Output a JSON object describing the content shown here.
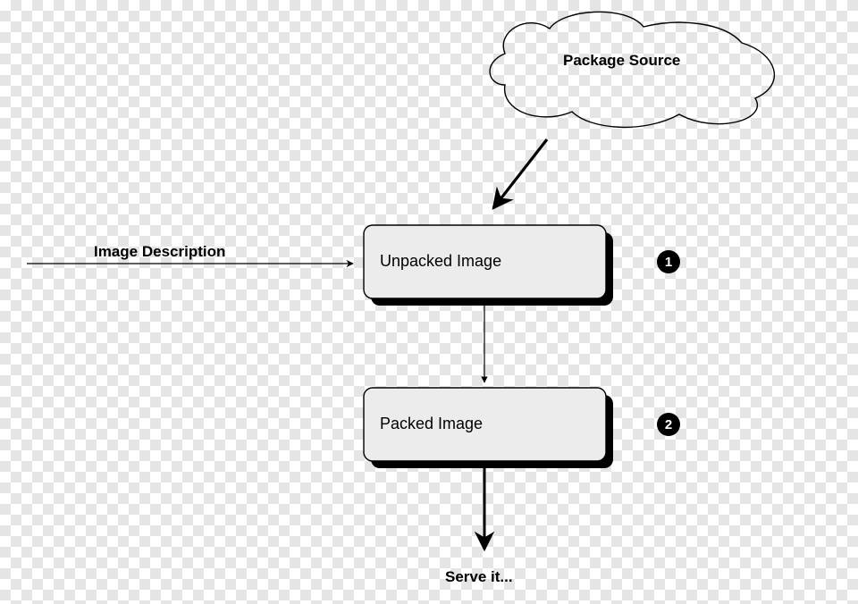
{
  "nodes": {
    "package_source": "Package Source",
    "image_description": "Image Description",
    "unpacked_image": "Unpacked Image",
    "packed_image": "Packed Image",
    "serve_it": "Serve it..."
  },
  "steps": {
    "one": "1",
    "two": "2"
  },
  "colors": {
    "box_fill": "#ececec",
    "stroke": "#000000"
  }
}
